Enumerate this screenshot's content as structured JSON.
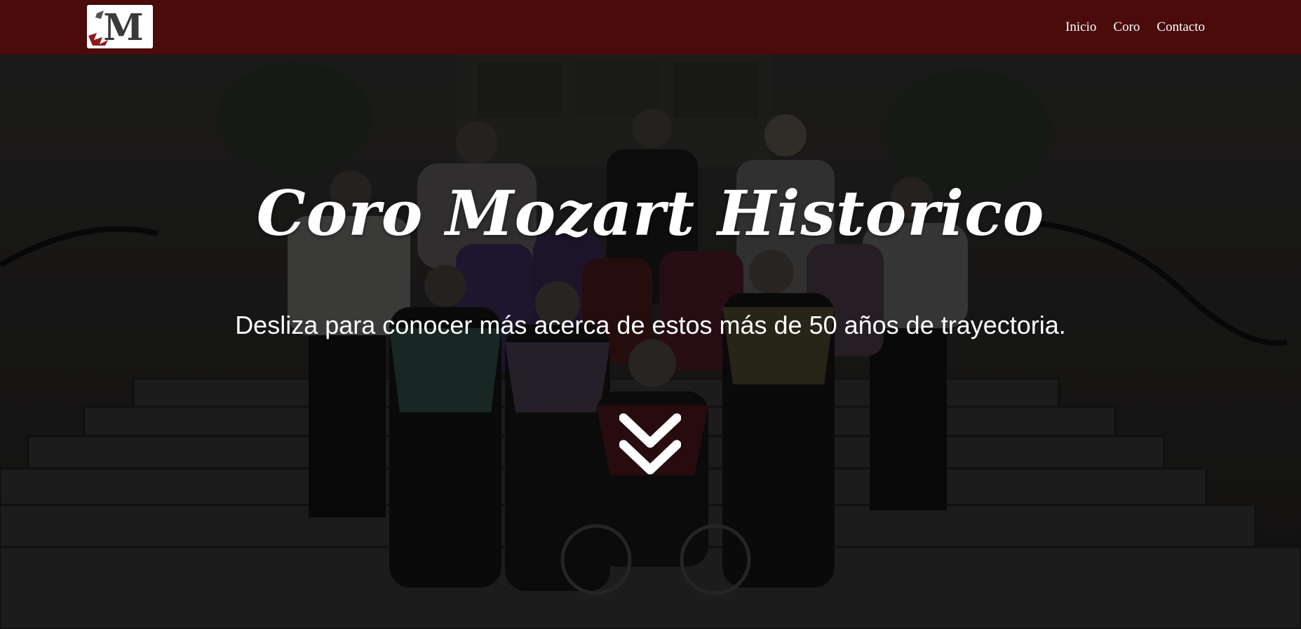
{
  "brand": {
    "logo_letter": "M",
    "logo_icon": "choir-monogram-logo"
  },
  "nav": {
    "items": [
      {
        "label": "Inicio"
      },
      {
        "label": "Coro"
      },
      {
        "label": "Contacto"
      }
    ]
  },
  "hero": {
    "title": "Coro Mozart Historico",
    "subtitle": "Desliza para conocer más acerca de estos más de 50 años de trayectoria.",
    "scroll_icon": "double-chevron-down-icon",
    "background_photo": "choir-group-photo-on-stairs"
  },
  "colors": {
    "navbar": "#4a0b0b",
    "text": "#ffffff"
  }
}
